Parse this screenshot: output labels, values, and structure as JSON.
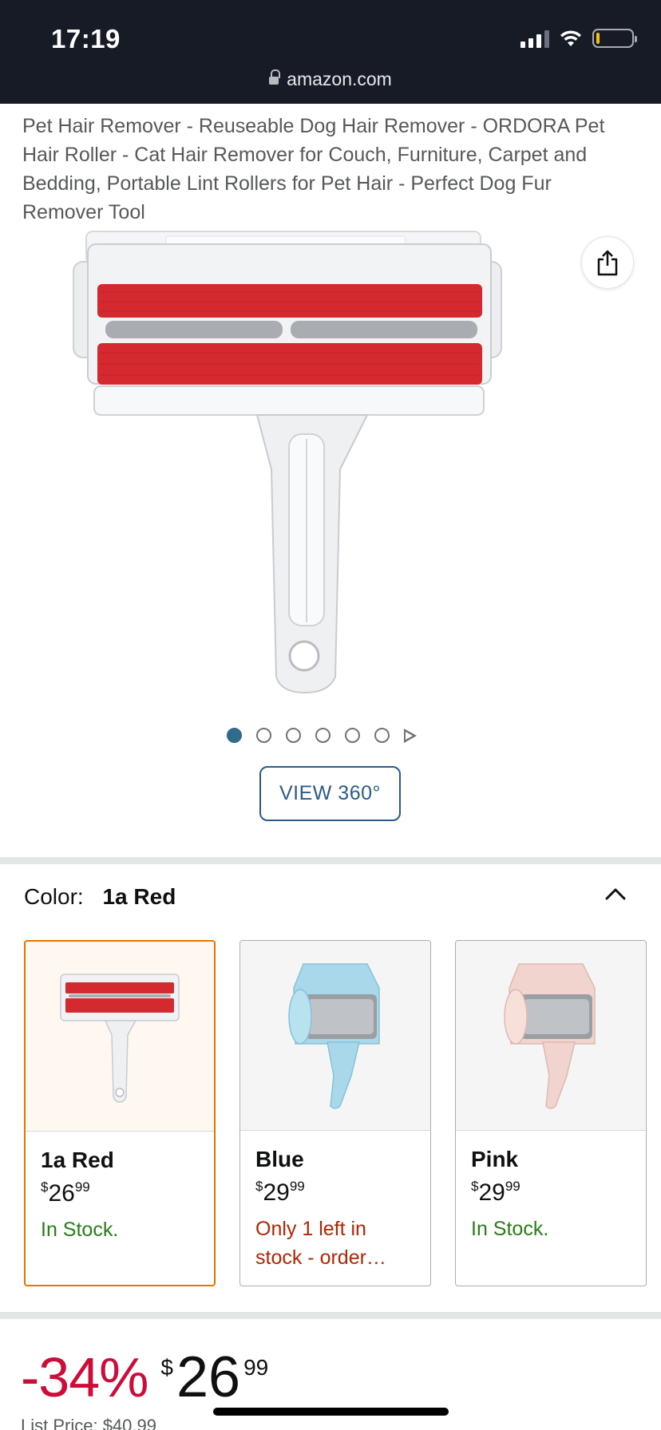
{
  "status_bar": {
    "time": "17:19"
  },
  "browser": {
    "url": "amazon.com"
  },
  "product": {
    "title": "Pet Hair Remover - Reuseable Dog Hair Remover - ORDORA Pet Hair Roller - Cat Hair Remover for Couch, Furniture, Carpet and Bedding, Portable Lint Rollers for Pet Hair - Perfect Dog Fur Remover Tool"
  },
  "gallery": {
    "dot_count": 6,
    "active_index": 0,
    "view_360_label": "VIEW 360°"
  },
  "color_selector": {
    "label": "Color:",
    "selected": "1a Red",
    "options": [
      {
        "name": "1a Red",
        "currency": "$",
        "whole": "26",
        "fraction": "99",
        "stock": "In Stock.",
        "stock_status": "in",
        "color": "#d32f2f"
      },
      {
        "name": "Blue",
        "currency": "$",
        "whole": "29",
        "fraction": "99",
        "stock": "Only 1 left in stock - order…",
        "stock_status": "low",
        "color": "#a8d8ea"
      },
      {
        "name": "Pink",
        "currency": "$",
        "whole": "29",
        "fraction": "99",
        "stock": "In Stock.",
        "stock_status": "in",
        "color": "#f2d4cf"
      }
    ]
  },
  "pricing": {
    "discount": "-34%",
    "currency": "$",
    "whole": "26",
    "fraction": "99",
    "list_price_label": "List Price: $40.99"
  },
  "colors": {
    "accent_blue": "#2b5b8a",
    "discount_red": "#cc0c39",
    "in_stock_green": "#2a7e18",
    "low_stock_red": "#b12704",
    "selected_border": "#e77600"
  }
}
